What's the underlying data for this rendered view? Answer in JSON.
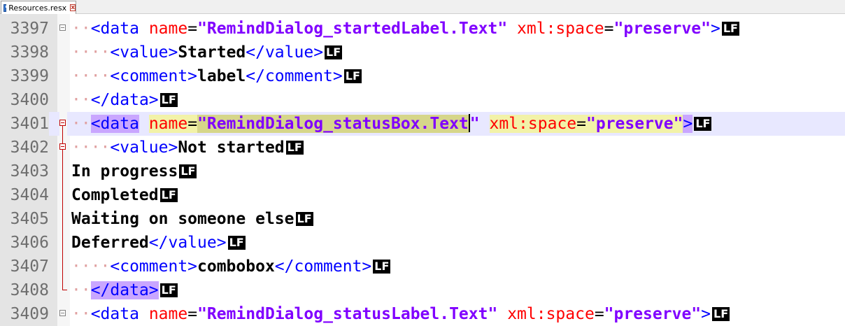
{
  "tab": {
    "title": "Resources.resx",
    "close_glyph": "x"
  },
  "editor": {
    "lines": [
      {
        "num": "3397",
        "indent": "··",
        "tag_open": "<data",
        "attr1": "name",
        "eq1": "=",
        "val1": "\"RemindDialog_startedLabel.Text\"",
        "attr2": "xml:space",
        "eq2": "=",
        "val2": "\"preserve\"",
        "tag_close": ">",
        "lf": "LF"
      },
      {
        "num": "3398",
        "indent": "····",
        "open": "<value>",
        "text": "Started",
        "close": "</value>",
        "lf": "LF"
      },
      {
        "num": "3399",
        "indent": "····",
        "open": "<comment>",
        "text": "label",
        "close": "</comment>",
        "lf": "LF"
      },
      {
        "num": "3400",
        "indent": "··",
        "close": "</data>",
        "lf": "LF"
      },
      {
        "num": "3401",
        "indent": "··",
        "tag_open": "<data",
        "attr1": "name",
        "eq1": "=",
        "val1": "\"RemindDialog_statusBox.Text",
        "val1_end": "\"",
        "attr2": "xml:space",
        "eq2": "=",
        "val2": "\"preserve\"",
        "tag_close": ">",
        "lf": "LF"
      },
      {
        "num": "3402",
        "indent": "····",
        "open": "<value>",
        "text": "Not started",
        "lf": "LF"
      },
      {
        "num": "3403",
        "text": "In progress",
        "lf": "LF"
      },
      {
        "num": "3404",
        "text": "Completed",
        "lf": "LF"
      },
      {
        "num": "3405",
        "text": "Waiting on someone else",
        "lf": "LF"
      },
      {
        "num": "3406",
        "text": "Deferred",
        "close": "</value>",
        "lf": "LF"
      },
      {
        "num": "3407",
        "indent": "····",
        "open": "<comment>",
        "text": "combobox",
        "close": "</comment>",
        "lf": "LF"
      },
      {
        "num": "3408",
        "indent": "··",
        "close": "</data>",
        "lf": "LF"
      },
      {
        "num": "3409",
        "indent": "··",
        "tag_open": "<data",
        "attr1": "name",
        "eq1": "=",
        "val1": "\"RemindDialog_statusLabel.Text\"",
        "attr2": "xml:space",
        "eq2": "=",
        "val2": "\"preserve\"",
        "tag_close": ">",
        "lf": "LF"
      }
    ]
  },
  "colors": {
    "tag": "#0000ff",
    "attr_name": "#ff0000",
    "attr_value": "#8000ff",
    "text": "#000000",
    "current_line": "#e8e8ff",
    "gutter": "#e4e4e4"
  }
}
